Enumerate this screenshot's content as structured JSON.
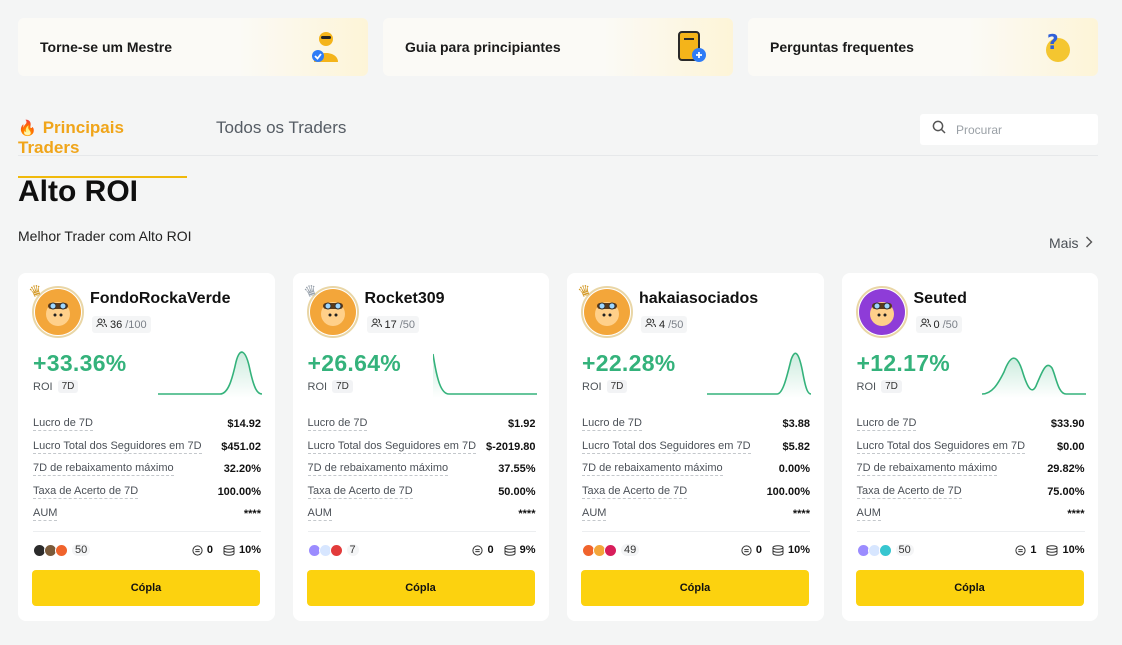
{
  "promos": [
    {
      "label": "Torne-se um Mestre",
      "icon": "master-trader-icon"
    },
    {
      "label": "Guia para principiantes",
      "icon": "beginner-guide-icon"
    },
    {
      "label": "Perguntas frequentes",
      "icon": "faq-icon"
    }
  ],
  "tabs": {
    "top": "Principais Traders",
    "all": "Todos os Traders"
  },
  "search": {
    "placeholder": "Procurar"
  },
  "section": {
    "title": "Alto ROI",
    "subtitle": "Melhor Trader com Alto ROI",
    "more": "Mais"
  },
  "stat_labels": {
    "profit7d": "Lucro de 7D",
    "followers_profit": "Lucro Total dos Seguidores em 7D",
    "max_drawdown": "7D de rebaixamento máximo",
    "win_rate": "Taxa de Acerto de 7D",
    "aum": "AUM"
  },
  "roi_label": "ROI",
  "roi_period": "7D",
  "copy_label": "Cópla",
  "cards": [
    {
      "name": "FondoRockaVerde",
      "followers": "36",
      "followers_max": "/100",
      "roi": "+33.36%",
      "crown": "gold",
      "avatar_color": "#f3a63a",
      "profit7d": "$14.92",
      "followers_profit": "$451.02",
      "max_drawdown": "32.20%",
      "win_rate": "100.00%",
      "aum": "****",
      "copiers": "50",
      "comments": "0",
      "share": "10%",
      "mini_colors": [
        "#2b2b2b",
        "#7a5a3a",
        "#f0632c"
      ]
    },
    {
      "name": "Rocket309",
      "followers": "17",
      "followers_max": "/50",
      "roi": "+26.64%",
      "crown": "silver",
      "avatar_color": "#f3a63a",
      "profit7d": "$1.92",
      "followers_profit": "$-2019.80",
      "max_drawdown": "37.55%",
      "win_rate": "50.00%",
      "aum": "****",
      "copiers": "7",
      "comments": "0",
      "share": "9%",
      "mini_colors": [
        "#9b8cff",
        "#d7e6ff",
        "#e23b3b"
      ]
    },
    {
      "name": "hakaiasociados",
      "followers": "4",
      "followers_max": "/50",
      "roi": "+22.28%",
      "crown": "gold",
      "avatar_color": "#f3a63a",
      "profit7d": "$3.88",
      "followers_profit": "$5.82",
      "max_drawdown": "0.00%",
      "win_rate": "100.00%",
      "aum": "****",
      "copiers": "49",
      "comments": "0",
      "share": "10%",
      "mini_colors": [
        "#f0632c",
        "#f3a63a",
        "#d81e5b"
      ]
    },
    {
      "name": "Seuted",
      "followers": "0",
      "followers_max": "/50",
      "roi": "+12.17%",
      "crown": "none",
      "avatar_color": "#8e3cd8",
      "profit7d": "$33.90",
      "followers_profit": "$0.00",
      "max_drawdown": "29.82%",
      "win_rate": "75.00%",
      "aum": "****",
      "copiers": "50",
      "comments": "1",
      "share": "10%",
      "mini_colors": [
        "#9b8cff",
        "#d7e6ff",
        "#37c6d0"
      ]
    }
  ]
}
